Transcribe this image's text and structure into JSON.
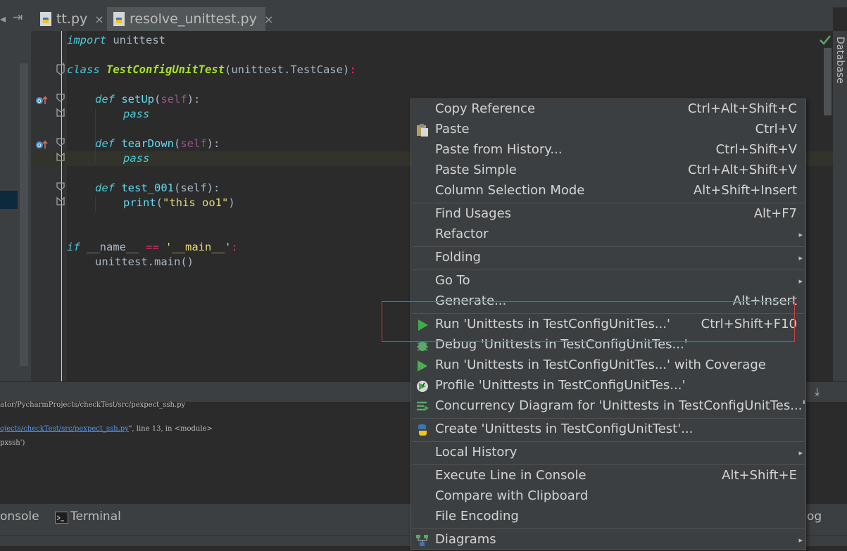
{
  "tabs": [
    {
      "label": "tt.py",
      "close": "×"
    },
    {
      "label": "resolve_unittest.py",
      "close": "×"
    }
  ],
  "code": {
    "line1": {
      "kw": "import",
      "rest": " unittest"
    },
    "line2": {
      "kw": "class",
      "name": "TestConfigUnitTest",
      "open": "(unittest.TestCase)",
      "colon": ":"
    },
    "line3": {
      "kw": "def",
      "name": "setUp",
      "p1": "(",
      "self": "self",
      "p2": "):"
    },
    "line4": {
      "kw": "pass"
    },
    "line5": {
      "kw": "def",
      "name": "tearDown",
      "p1": "(",
      "self": "self",
      "p2": "):"
    },
    "line6": {
      "kw": "pass"
    },
    "line7": {
      "kw": "def",
      "name": "test_001",
      "p1": "(self):"
    },
    "line8": {
      "fn": "print",
      "p1": "(",
      "str": "\"this oo1\"",
      "p2": ")"
    },
    "line9": {
      "kw": "if",
      "a": " __name__ ",
      "op": "==",
      "b": " ",
      "str": "'__main__'",
      "colon": ":"
    },
    "line10": {
      "text": "unittest.main()"
    }
  },
  "right_panel": {
    "label": "Database"
  },
  "run_output": {
    "line1": "ator/PycharmProjects/checkTest/src/pexpect_ssh.py",
    "line2_link": "ojects/checkTest/src/pexpect_ssh.py",
    "line2_rest": "\", line 13, in <module>",
    "line3": "pxssh')"
  },
  "bottom_bar": {
    "console": "onsole",
    "terminal": "Terminal",
    "log": "og"
  },
  "menu": {
    "items": [
      {
        "label": "Copy Reference",
        "shortcut": "Ctrl+Alt+Shift+C"
      },
      {
        "label": "Paste",
        "shortcut": "Ctrl+V"
      },
      {
        "label": "Paste from History...",
        "shortcut": "Ctrl+Shift+V"
      },
      {
        "label": "Paste Simple",
        "shortcut": "Ctrl+Alt+Shift+V"
      },
      {
        "label": "Column Selection Mode",
        "shortcut": "Alt+Shift+Insert"
      },
      {
        "label": "Find Usages",
        "shortcut": "Alt+F7"
      },
      {
        "label": "Refactor",
        "shortcut": ""
      },
      {
        "label": "Folding",
        "shortcut": ""
      },
      {
        "label": "Go To",
        "shortcut": ""
      },
      {
        "label": "Generate...",
        "shortcut": "Alt+Insert"
      },
      {
        "label": "Run 'Unittests in TestConfigUnitTes...'",
        "shortcut": "Ctrl+Shift+F10"
      },
      {
        "label": "Debug 'Unittests in TestConfigUnitTes...'",
        "shortcut": ""
      },
      {
        "label": "Run 'Unittests in TestConfigUnitTes...' with Coverage",
        "shortcut": ""
      },
      {
        "label": "Profile 'Unittests in TestConfigUnitTes...'",
        "shortcut": ""
      },
      {
        "label": "Concurrency Diagram for  'Unittests in TestConfigUnitTes...'",
        "shortcut": ""
      },
      {
        "label": "Create 'Unittests in TestConfigUnitTest'...",
        "shortcut": ""
      },
      {
        "label": "Local History",
        "shortcut": ""
      },
      {
        "label": "Execute Line in Console",
        "shortcut": "Alt+Shift+E"
      },
      {
        "label": "Compare with Clipboard",
        "shortcut": ""
      },
      {
        "label": "File Encoding",
        "shortcut": ""
      },
      {
        "label": "Diagrams",
        "shortcut": ""
      }
    ],
    "submenu_arrow": "▸"
  },
  "colors": {
    "accent_run": "#3fad46",
    "highlight_box": "#d04040"
  },
  "icons": [
    "python-file-icon",
    "close-icon",
    "paste-icon",
    "run-icon",
    "debug-icon",
    "coverage-icon",
    "profile-icon",
    "concurrency-icon",
    "python-icon",
    "diagram-icon",
    "checkmark-icon",
    "terminal-icon"
  ]
}
